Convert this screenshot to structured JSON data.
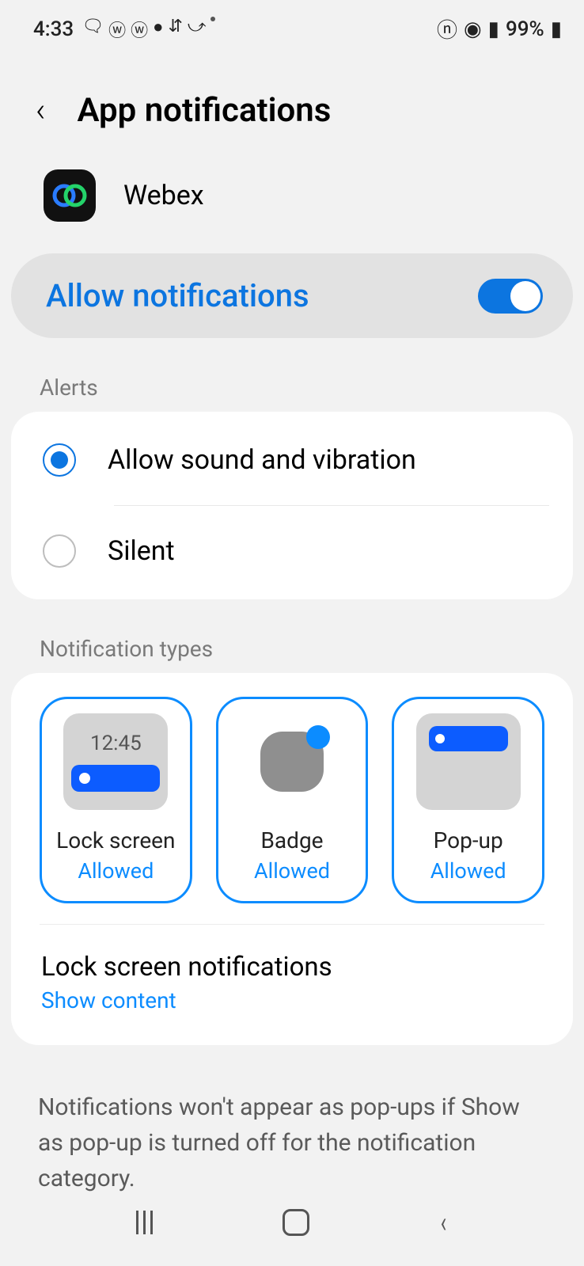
{
  "status": {
    "time": "4:33",
    "battery": "99%"
  },
  "header": {
    "title": "App notifications"
  },
  "app": {
    "name": "Webex"
  },
  "allow": {
    "label": "Allow notifications"
  },
  "sections": {
    "alerts": "Alerts",
    "types": "Notification types"
  },
  "alerts": {
    "sound": "Allow sound and vibration",
    "silent": "Silent"
  },
  "tiles": {
    "lock": {
      "title": "Lock screen",
      "status": "Allowed",
      "preview_time": "12:45"
    },
    "badge": {
      "title": "Badge",
      "status": "Allowed"
    },
    "popup": {
      "title": "Pop-up",
      "status": "Allowed"
    }
  },
  "lockscreen_notifications": {
    "title": "Lock screen notifications",
    "value": "Show content"
  },
  "note": "Notifications won't appear as pop-ups if Show as pop-up is turned off for the notification category."
}
